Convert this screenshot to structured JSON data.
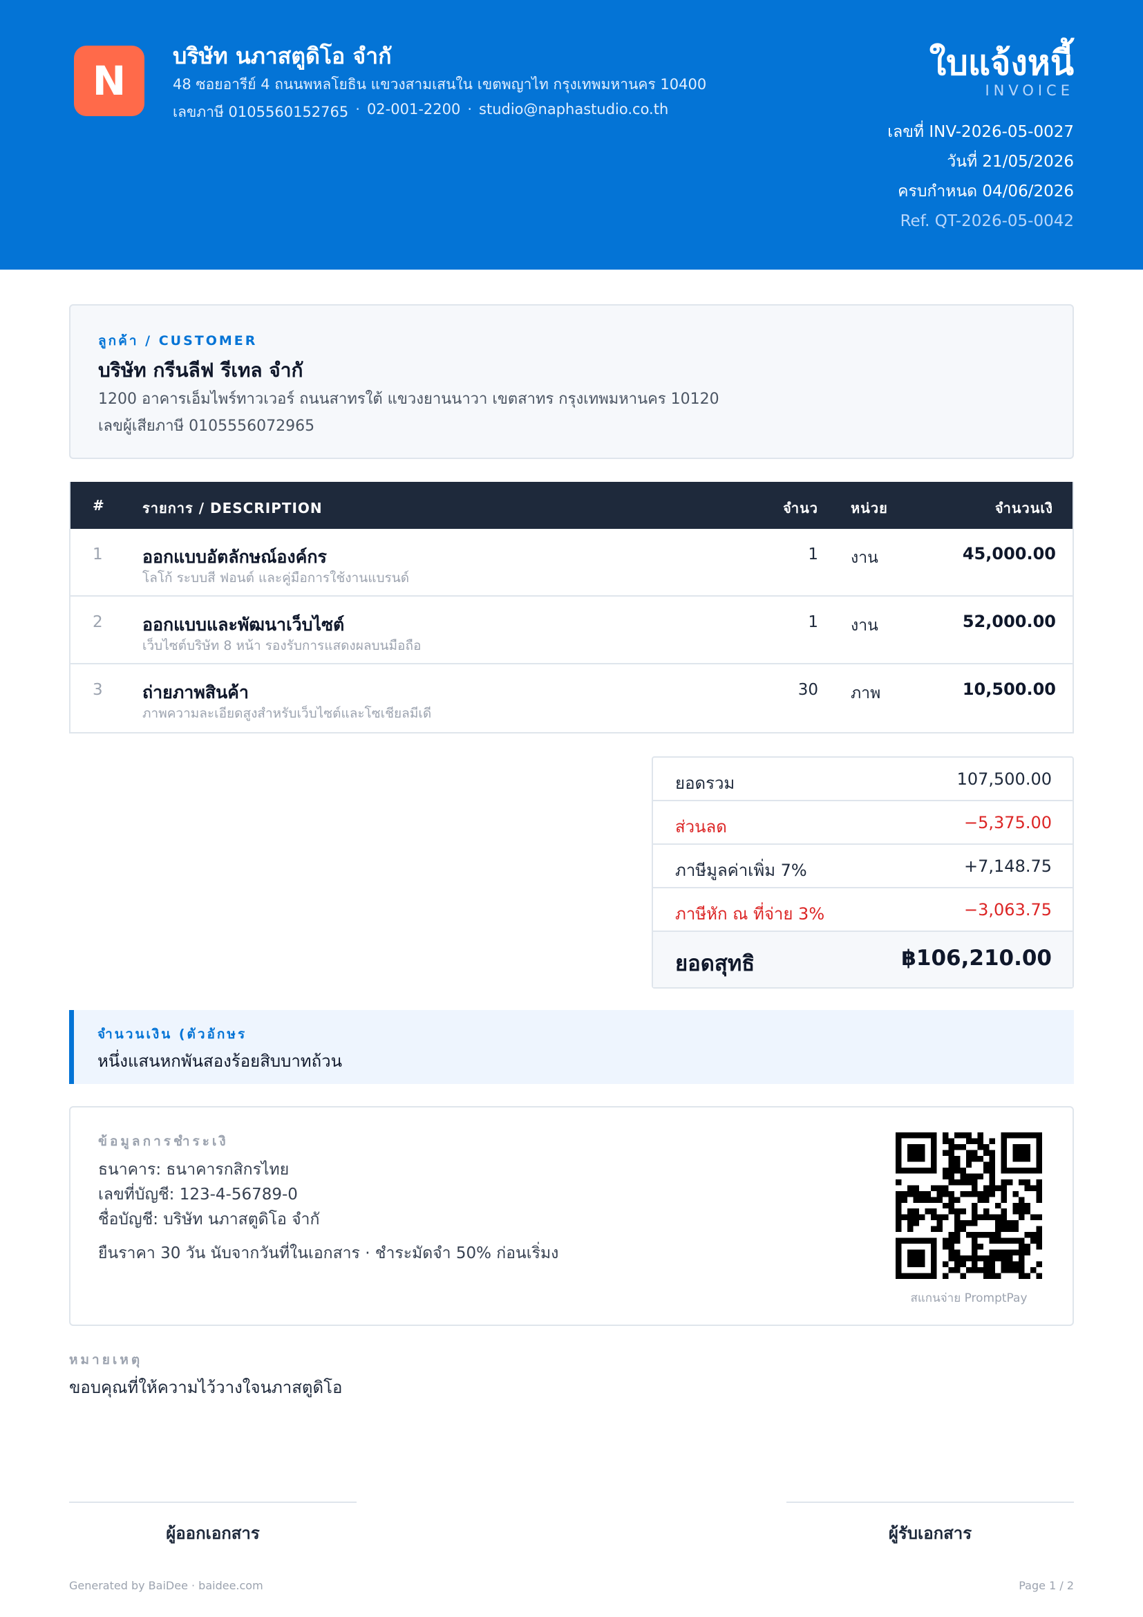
{
  "header": {
    "logo_letter": "N",
    "company_name": "บริษัท นภาสตูดิโอ จำกั",
    "company_address": "48 ซอยอารีย์ 4 ถนนพหลโยธิน แขวงสามเสนใน เขตพญาไท กรุงเทพมหานคร 10400",
    "tax_id": "เลขภาษี 0105560152765",
    "phone": "02-001-2200",
    "email": "studio@naphastudio.co.th",
    "separator": "·",
    "title": "ใบแจ้งหนี้",
    "subtitle": "INVOICE",
    "number": "เลขที่ INV-2026-05-0027",
    "date": "วันที่ 21/05/2026",
    "due": "ครบกำหนด 04/06/2026",
    "ref": "Ref. QT-2026-05-0042",
    "colors": {
      "band": "#0474d6",
      "logo": "#ff6a4a"
    }
  },
  "customer": {
    "label": "ลูกค้า / CUSTOMER",
    "name": "บริษัท กรีนลีฟ รีเทล จำกั",
    "address": "1200 อาคารเอ็มไพร์ทาวเวอร์ ถนนสาทรใต้ แขวงยานนาวา เขตสาทร กรุงเทพมหานคร 10120",
    "tax": "เลขผู้เสียภาษี 0105556072965"
  },
  "items": {
    "headers": {
      "index": "#",
      "description": "รายการ / DESCRIPTION",
      "qty": "จำนว",
      "unit": "หน่วย",
      "amount": "จำนวนเงิ"
    },
    "rows": [
      {
        "index": "1",
        "name": "ออกแบบอัตลักษณ์องค์กร",
        "desc": "โลโก้ ระบบสี ฟอนต์ และคู่มือการใช้งานแบรนด์",
        "qty": "1",
        "unit": "งาน",
        "amount": "45,000.00"
      },
      {
        "index": "2",
        "name": "ออกแบบและพัฒนาเว็บไซต์",
        "desc": "เว็บไซต์บริษัท 8 หน้า รองรับการแสดงผลบนมือถือ",
        "qty": "1",
        "unit": "งาน",
        "amount": "52,000.00"
      },
      {
        "index": "3",
        "name": "ถ่ายภาพสินค้า",
        "desc": "ภาพความละเอียดสูงสำหรับเว็บไซต์และโซเชียลมีเดี",
        "qty": "30",
        "unit": "ภาพ",
        "amount": "10,500.00"
      }
    ]
  },
  "totals": {
    "subtotal_label": "ยอดรวม",
    "subtotal": "107,500.00",
    "discount_label": "ส่วนลด",
    "discount": "−5,375.00",
    "vat_label": "ภาษีมูลค่าเพิ่ม 7%",
    "vat": "+7,148.75",
    "wht_label": "ภาษีหัก ณ ที่จ่าย 3%",
    "wht": "−3,063.75",
    "net_label": "ยอดสุทธิ",
    "net": "฿106,210.00",
    "negative_color": "#dc2626"
  },
  "amount_words": {
    "label": "จำนวนเงิน (ตัวอักษร",
    "text": "หนึ่งแสนหกพันสองร้อยสิบบาทถ้วน"
  },
  "payment": {
    "label": "ข้อมูลการชำระเงิ",
    "bank": "ธนาคาร: ธนาคารกสิกรไทย",
    "account_no": "เลขที่บัญชี: 123-4-56789-0",
    "account_name": "ชื่อบัญชี: บริษัท นภาสตูดิโอ จำกั",
    "terms": "ยืนราคา 30 วัน นับจากวันที่ในเอกสาร · ชำระมัดจำ 50% ก่อนเริ่มง",
    "qr_caption": "สแกนจ่าย PromptPay"
  },
  "remark": {
    "label": "หมายเหตุ",
    "text": "ขอบคุณที่ให้ความไว้วางใจนภาสตูดิโอ"
  },
  "signatures": {
    "issuer": "ผู้ออกเอกสาร",
    "receiver": "ผู้รับเอกสาร"
  },
  "footer": {
    "generated": "Generated by BaiDee · baidee.com",
    "page": "Page 1 / 2"
  }
}
